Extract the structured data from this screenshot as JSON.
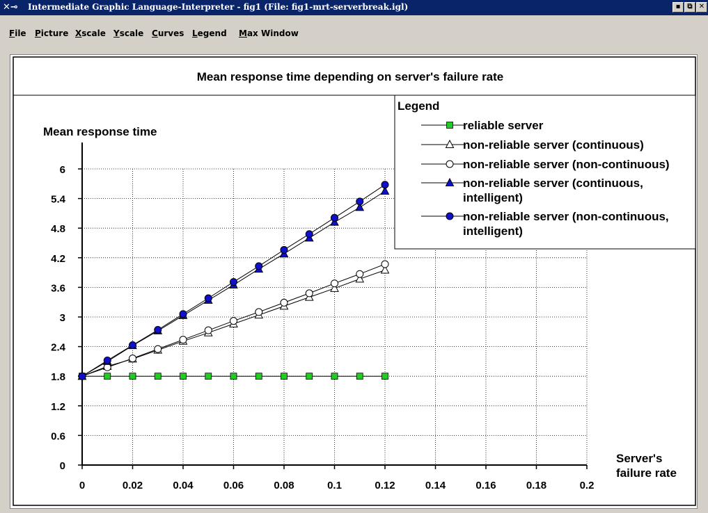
{
  "window": {
    "title": "Intermediate Graphic Language-Interpreter - fig1 (File: fig1-mrt-serverbreak.igl)",
    "app_icon": "x-terminal-icon"
  },
  "menu": {
    "file": {
      "mnemonic": "F",
      "rest": "ile"
    },
    "picture": {
      "mnemonic": "P",
      "rest": "icture"
    },
    "xscale": {
      "mnemonic": "X",
      "rest": "scale"
    },
    "yscale": {
      "mnemonic": "Y",
      "rest": "scale"
    },
    "curves": {
      "mnemonic": "C",
      "rest": "urves"
    },
    "legend": {
      "mnemonic": "L",
      "rest": "egend"
    },
    "maxwindow": {
      "mnemonic": "M",
      "rest": "ax Window"
    }
  },
  "chart_data": {
    "type": "line",
    "title": "Mean response time depending on server's failure rate",
    "ylabel": "Mean response time",
    "xlabel_lines": [
      "Server's",
      "failure rate"
    ],
    "legend_title": "Legend",
    "xlim": [
      0,
      0.2
    ],
    "ylim": [
      0,
      6
    ],
    "xticks": [
      0,
      0.02,
      0.04,
      0.06,
      0.08,
      0.1,
      0.12,
      0.14,
      0.16,
      0.18,
      0.2
    ],
    "xtick_labels": [
      "0",
      "0.02",
      "0.04",
      "0.06",
      "0.08",
      "0.1",
      "0.12",
      "0.14",
      "0.16",
      "0.18",
      "0.2"
    ],
    "yticks": [
      0,
      0.6,
      1.2,
      1.8,
      2.4,
      3,
      3.6,
      4.2,
      4.8,
      5.4,
      6
    ],
    "ytick_labels": [
      "0",
      "0.6",
      "1.2",
      "1.8",
      "2.4",
      "3",
      "3.6",
      "4.2",
      "4.8",
      "5.4",
      "6"
    ],
    "grid": true,
    "legend_position": "top-right",
    "x": [
      0,
      0.01,
      0.02,
      0.03,
      0.04,
      0.05,
      0.06,
      0.07,
      0.08,
      0.09,
      0.1,
      0.11,
      0.12
    ],
    "series": [
      {
        "name_lines": [
          "reliable server"
        ],
        "marker": "square",
        "color": "#22cc22",
        "values": [
          1.8,
          1.8,
          1.8,
          1.8,
          1.8,
          1.8,
          1.8,
          1.8,
          1.8,
          1.8,
          1.8,
          1.8,
          1.8
        ]
      },
      {
        "name_lines": [
          "non-reliable server (continuous)"
        ],
        "marker": "triangle-open",
        "color": "#ffffff",
        "values": [
          1.8,
          2.0,
          2.15,
          2.33,
          2.51,
          2.68,
          2.86,
          3.04,
          3.22,
          3.4,
          3.58,
          3.77,
          3.95
        ]
      },
      {
        "name_lines": [
          "non-reliable server (non-continuous)"
        ],
        "marker": "circle-open",
        "color": "#ffffff",
        "values": [
          1.8,
          1.98,
          2.16,
          2.35,
          2.54,
          2.73,
          2.92,
          3.1,
          3.29,
          3.48,
          3.68,
          3.87,
          4.07
        ]
      },
      {
        "name_lines": [
          "non-reliable server (continuous,",
          "intelligent)"
        ],
        "marker": "triangle-filled",
        "color": "#1010cc",
        "values": [
          1.8,
          2.1,
          2.42,
          2.72,
          3.03,
          3.34,
          3.65,
          3.97,
          4.28,
          4.6,
          4.92,
          5.22,
          5.55
        ]
      },
      {
        "name_lines": [
          "non-reliable server (non-continuous,",
          "intelligent)"
        ],
        "marker": "circle-filled",
        "color": "#1010cc",
        "values": [
          1.8,
          2.12,
          2.43,
          2.74,
          3.06,
          3.38,
          3.71,
          4.03,
          4.36,
          4.68,
          5.01,
          5.34,
          5.68
        ]
      }
    ]
  }
}
